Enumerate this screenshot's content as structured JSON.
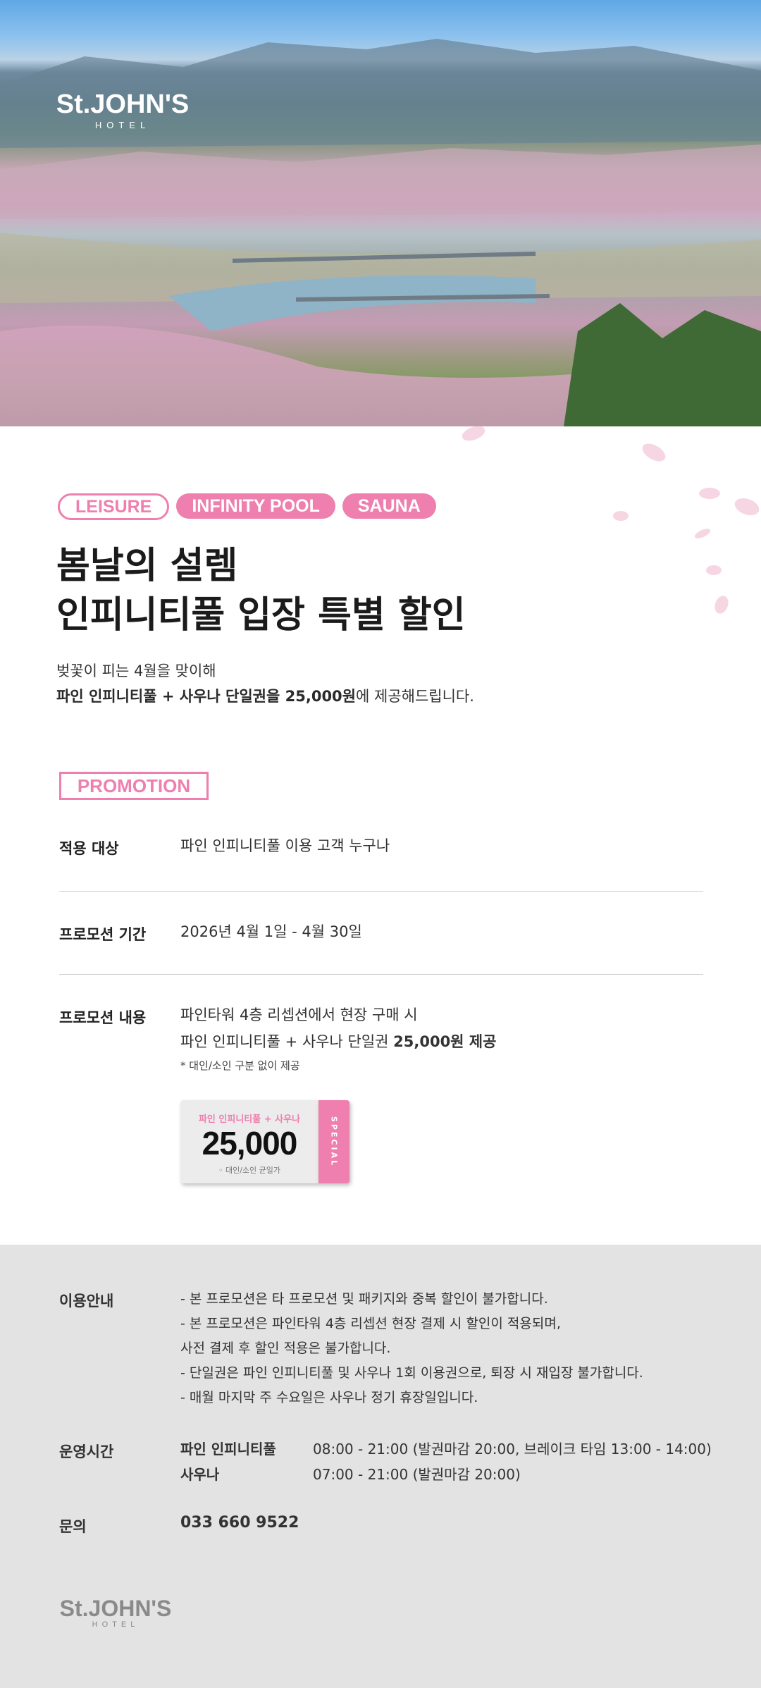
{
  "hero": {
    "logo_brand": "St.JOHN'S",
    "logo_sub": "HOTEL"
  },
  "tags": [
    "LEISURE",
    "INFINITY POOL",
    "SAUNA"
  ],
  "title": {
    "line1": "봄날의 설렘",
    "line2": "인피니티풀 입장 특별 할인"
  },
  "intro": {
    "line1": "벚꽃이 피는 4월을 맞이해",
    "line2_bold": "파인 인피니티풀 + 사우나 단일권을 25,000원",
    "line2_rest": "에 제공해드립니다."
  },
  "promotion": {
    "label": "PROMOTION",
    "rows": [
      {
        "label": "적용 대상",
        "value": "파인 인피니티풀 이용 고객 누구나"
      },
      {
        "label": "프로모션 기간",
        "value": "2026년 4월 1일 - 4월 30일"
      },
      {
        "label": "프로모션 내용",
        "line1": "파인타워 4층 리셉션에서 현장 구매 시",
        "line2_pre": "파인 인피니티풀 + 사우나 단일권 ",
        "line2_bold": "25,000원 제공",
        "note": "* 대인/소인 구분 없이 제공"
      }
    ]
  },
  "ticket": {
    "title": "파인 인피니티풀 + 사우나",
    "price": "25,000",
    "note": "◦ 대인/소인 균일가",
    "stub": "SPECIAL"
  },
  "footer": {
    "usage_label": "이용안내",
    "notes": [
      "-  본 프로모션은 타 프로모션 및 패키지와 중복 할인이 불가합니다.",
      "-  본 프로모션은 파인타워 4층 리셉션 현장 결제 시 할인이 적용되며,",
      "    사전 결제 후 할인 적용은 불가합니다.",
      "-  단일권은 파인 인피니티풀 및 사우나 1회 이용권으로, 퇴장 시 재입장 불가합니다.",
      "-  매월 마지막 주 수요일은 사우나 정기 휴장일입니다."
    ],
    "hours_label": "운영시간",
    "hours": [
      {
        "name": "파인 인피니티풀",
        "time": "08:00  -  21:00 (발권마감 20:00, 브레이크 타임 13:00 - 14:00)"
      },
      {
        "name": "사우나",
        "time": "07:00  -  21:00 (발권마감 20:00)"
      }
    ],
    "contact_label": "문의",
    "phone": "033 660 9522",
    "logo_brand": "St.JOHN'S",
    "logo_sub": "HOTEL"
  },
  "colors": {
    "accent": "#ee7fae",
    "footer_bg": "#e3e3e3"
  }
}
